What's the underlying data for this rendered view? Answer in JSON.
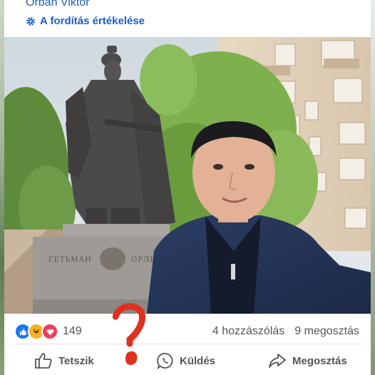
{
  "post": {
    "author": "Orbán Viktor",
    "translate_label": "A fordítás értékelése"
  },
  "photo": {
    "plaque_left": "ГЕТЬМАН",
    "plaque_right": "ОРЛИК"
  },
  "stats": {
    "reaction_icons": [
      "like-icon",
      "haha-icon",
      "love-icon"
    ],
    "reaction_count": "149",
    "comments": "4 hozzászólás",
    "shares": "9 megosztás"
  },
  "actions": {
    "like_label": "Tetszik",
    "send_label": "Küldés",
    "share_label": "Megosztás"
  },
  "colors": {
    "link": "#1d5fbf",
    "like": "#1877f2",
    "love": "#f33e58",
    "haha": "#f7b125",
    "annotation": "#e0301e"
  }
}
